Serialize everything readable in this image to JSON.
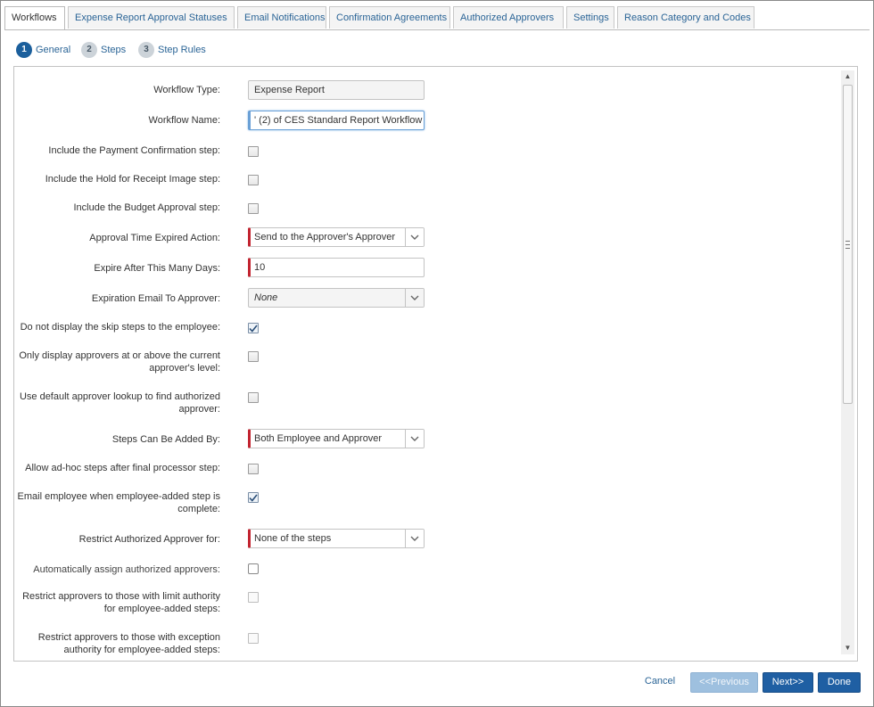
{
  "tabs": [
    {
      "label": "Workflows",
      "active": true
    },
    {
      "label": "Expense Report Approval Statuses",
      "active": false
    },
    {
      "label": "Email Notifications",
      "active": false
    },
    {
      "label": "Confirmation Agreements",
      "active": false
    },
    {
      "label": "Authorized Approvers",
      "active": false
    },
    {
      "label": "Settings",
      "active": false
    },
    {
      "label": "Reason Category and Codes",
      "active": false
    }
  ],
  "wizard": [
    {
      "num": "1",
      "label": "General",
      "active": true
    },
    {
      "num": "2",
      "label": "Steps",
      "active": false
    },
    {
      "num": "3",
      "label": "Step Rules",
      "active": false
    }
  ],
  "form": {
    "workflow_type": {
      "label": "Workflow Type:",
      "value": "Expense Report"
    },
    "workflow_name": {
      "label": "Workflow Name:",
      "value": "' (2) of CES Standard Report Workflow"
    },
    "payment_confirmation": {
      "label": "Include the Payment Confirmation step:",
      "checked": false
    },
    "hold_receipt": {
      "label": "Include the Hold for Receipt Image step:",
      "checked": false
    },
    "budget_approval": {
      "label": "Include the Budget Approval step:",
      "checked": false
    },
    "approval_time_expired": {
      "label": "Approval Time Expired Action:",
      "value": "Send to the Approver's Approver"
    },
    "expire_days": {
      "label": "Expire After This Many Days:",
      "value": "10"
    },
    "expiration_email": {
      "label": "Expiration Email To Approver:",
      "value": "None"
    },
    "skip_steps": {
      "label": "Do not display the skip steps to the employee:",
      "checked": true
    },
    "only_display_approvers": {
      "label_line1": "Only display approvers at or above the current",
      "label_line2": "approver's level:",
      "checked": false
    },
    "default_lookup": {
      "label_line1": "Use default approver lookup to find authorized",
      "label_line2": "approver:",
      "checked": false
    },
    "steps_added_by": {
      "label": "Steps Can Be Added By:",
      "value": "Both Employee and Approver"
    },
    "adhoc_after_final": {
      "label": "Allow ad-hoc steps after final processor step:",
      "checked": false
    },
    "email_employee": {
      "label_line1": "Email employee when employee-added step is",
      "label_line2": "complete:",
      "checked": true
    },
    "restrict_authorized": {
      "label": "Restrict Authorized Approver for:",
      "value": "None of the steps"
    },
    "auto_assign": {
      "label": "Automatically assign authorized approvers:",
      "checked": false
    },
    "restrict_limit": {
      "label_line1": "Restrict approvers to those with limit authority",
      "label_line2": "for employee-added steps:",
      "checked": false
    },
    "restrict_exception": {
      "label_line1": "Restrict approvers to those with exception",
      "label_line2": "authority for employee-added steps:",
      "checked": false
    }
  },
  "footer": {
    "cancel_label": "Cancel",
    "previous_label": "<<Previous",
    "next_label": "Next>>",
    "done_label": "Done"
  },
  "colors": {
    "accent": "#1f5fa3",
    "required": "#c2232f",
    "link": "#2a6496"
  }
}
